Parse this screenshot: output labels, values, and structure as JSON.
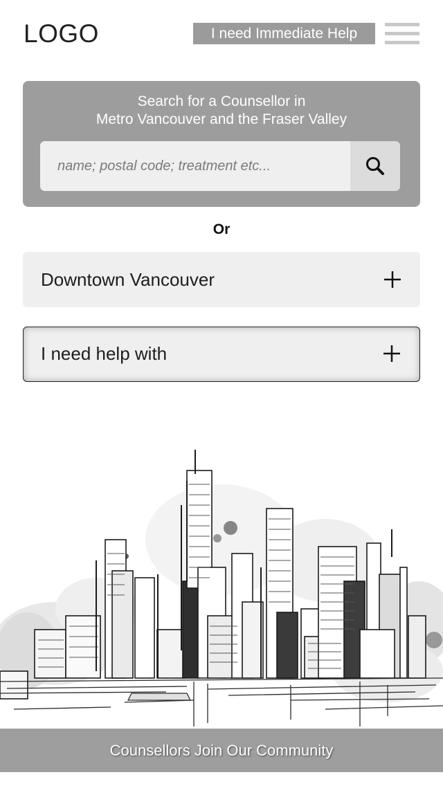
{
  "header": {
    "logo": "LOGO",
    "help_button": "I need Immediate Help",
    "menu_icon": "hamburger-menu-icon"
  },
  "search": {
    "title_line1": "Search for a Counsellor in",
    "title_line2": "Metro Vancouver and the Fraser Valley",
    "placeholder": "name; postal code; treatment etc...",
    "button_icon": "search-icon"
  },
  "or_label": "Or",
  "location": {
    "label": "Downtown Vancouver",
    "icon": "plus-icon"
  },
  "help_with": {
    "label": "I need help with",
    "icon": "plus-icon"
  },
  "illustration": "city-skyline-sketch",
  "footer": {
    "label": "Counsellors Join Our Community"
  },
  "colors": {
    "banner_gray": "#9d9d9d",
    "field_gray": "#efefef",
    "menu_bar_gray": "#c8c8c8",
    "text_dark": "#1a1a1a"
  }
}
